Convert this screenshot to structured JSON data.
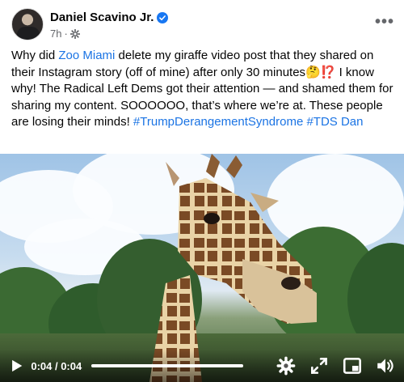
{
  "post": {
    "author": "Daniel Scavino Jr.",
    "time": "7h",
    "text_parts": [
      "Why did ",
      "Zoo Miami",
      " delete my giraffe video post that they shared on their Instagram story (off of mine) after only 30 minutes",
      "🤔⁉️",
      " I know why! The Radical Left Dems got their attention — and shamed them for sharing my content. SOOOOOO, that’s where we’re at. These people are losing their minds! ",
      "#TrumpDerangementSyndrome",
      " ",
      "#TDS",
      " ",
      "Dan"
    ]
  },
  "video": {
    "time_display": "0:04 / 0:04",
    "progress": 1.0
  },
  "colors": {
    "link": "#1b74e4",
    "verified": "#1877f2",
    "meta": "#65676b"
  },
  "icons": [
    "verified-badge-icon",
    "privacy-gear-icon",
    "more-options-icon",
    "play-icon",
    "settings-gear-icon",
    "fullscreen-icon",
    "picture-in-picture-icon",
    "volume-icon"
  ]
}
